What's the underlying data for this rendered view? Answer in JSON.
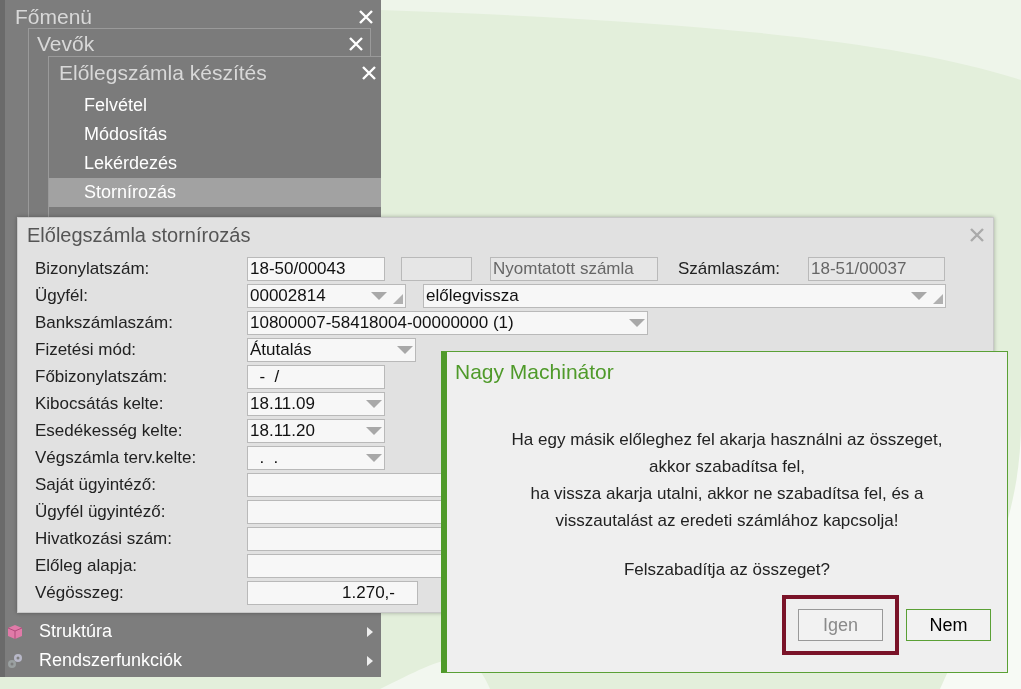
{
  "main_menu": {
    "title": "Főmenü",
    "windows": [
      {
        "title": "Vevők"
      },
      {
        "title": "Előlegszámla készítés",
        "items": [
          {
            "label": "Felvétel",
            "selected": false
          },
          {
            "label": "Módosítás",
            "selected": false
          },
          {
            "label": "Lekérdezés",
            "selected": false
          },
          {
            "label": "Stornírozás",
            "selected": true
          }
        ]
      }
    ],
    "bottom_items": [
      {
        "label": "Struktúra",
        "kind": "cube"
      },
      {
        "label": "Rendszerfunkciók",
        "kind": "gears"
      }
    ]
  },
  "form": {
    "title": "Előlegszámla stornírozás",
    "rows": [
      {
        "label": "Bizonylatszám:",
        "fields": [
          {
            "kind": "text",
            "value": "18-50/00043",
            "readonly": false
          },
          {
            "kind": "text",
            "readonly": true
          },
          {
            "kind": "text",
            "value": "Nyomtatott számla",
            "readonly": true
          },
          {
            "kind": "label",
            "value": "Számlaszám:"
          },
          {
            "kind": "text",
            "value": "18-51/00037",
            "readonly": true
          }
        ]
      },
      {
        "label": "Ügyfél:",
        "fields": [
          {
            "kind": "combo",
            "value": "00002814",
            "resizable": true
          },
          {
            "kind": "combo",
            "value": "előlegvissza",
            "resizable": true
          }
        ]
      },
      {
        "label": "Bankszámlaszám:",
        "fields": [
          {
            "kind": "combo",
            "value": "10800007-58418004-00000000 (1)",
            "resizable": false
          }
        ]
      },
      {
        "label": "Fizetési mód:",
        "fields": [
          {
            "kind": "combo",
            "value": "Átutalás",
            "resizable": false
          }
        ]
      },
      {
        "label": "Főbizonylatszám:",
        "fields": [
          {
            "kind": "text",
            "value": "  -  /",
            "readonly": false
          }
        ]
      },
      {
        "label": "Kibocsátás kelte:",
        "fields": [
          {
            "kind": "combo",
            "value": "18.11.09",
            "resizable": false
          }
        ]
      },
      {
        "label": "Esedékesség kelte:",
        "fields": [
          {
            "kind": "combo",
            "value": "18.11.20",
            "resizable": false
          }
        ]
      },
      {
        "label": "Végszámla terv.kelte:",
        "fields": [
          {
            "kind": "combo",
            "value": "  .  .",
            "resizable": false
          }
        ]
      },
      {
        "label": "Saját ügyintéző:",
        "fields": [
          {
            "kind": "text",
            "readonly": false
          }
        ]
      },
      {
        "label": "Ügyfél ügyintéző:",
        "fields": [
          {
            "kind": "text",
            "readonly": false
          }
        ]
      },
      {
        "label": "Hivatkozási szám:",
        "fields": [
          {
            "kind": "text",
            "readonly": false
          }
        ]
      },
      {
        "label": "Előleg alapja:",
        "fields": [
          {
            "kind": "text",
            "readonly": false
          }
        ]
      },
      {
        "label": "Végösszeg:",
        "fields": [
          {
            "kind": "amount",
            "value": "1.270,-",
            "readonly": false
          }
        ]
      }
    ]
  },
  "dialog": {
    "title": "Nagy Machinátor",
    "message_lines": [
      "Ha egy másik előleghez fel akarja használni az összeget,",
      "akkor szabadítsa fel,",
      "ha vissza akarja utalni, akkor ne szabadítsa fel, és a",
      "visszautalást az eredeti számlához kapcsolja!"
    ],
    "question": "Felszabadítja az összeget?",
    "buttons": [
      {
        "label": "Igen",
        "disabled": true,
        "highlighted": true
      },
      {
        "label": "Nem",
        "disabled": false,
        "highlighted": false
      }
    ]
  }
}
